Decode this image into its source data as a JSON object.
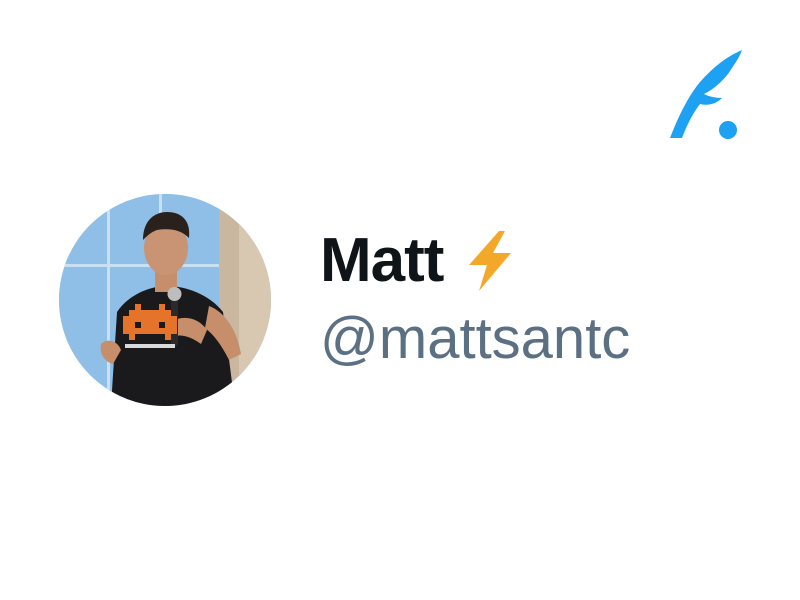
{
  "brand": {
    "logo_icon": "quill-feather-icon",
    "accent_color": "#1da1f2"
  },
  "profile": {
    "avatar_icon": "avatar-photo",
    "display_name": "Matt",
    "name_emoji_icon": "high-voltage-icon",
    "handle": "@mattsantc"
  },
  "colors": {
    "name": "#0f1419",
    "handle": "#5b7083",
    "bolt": "#f4a82a"
  }
}
